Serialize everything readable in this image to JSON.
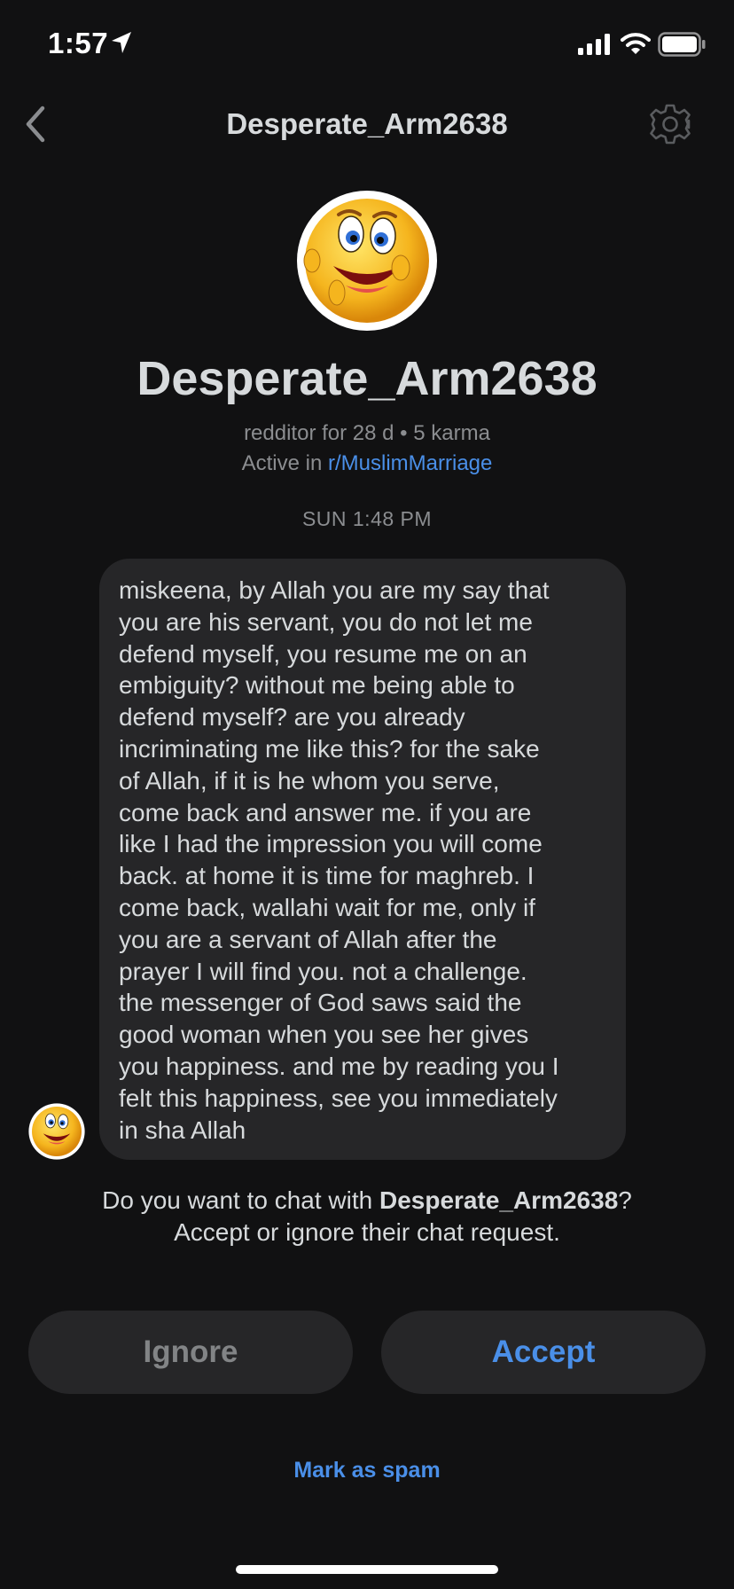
{
  "status_bar": {
    "time": "1:57"
  },
  "header": {
    "title": "Desperate_Arm2638",
    "back_icon": "chevron-left-icon",
    "settings_icon": "gear-icon"
  },
  "profile": {
    "name": "Desperate_Arm2638",
    "meta": "redditor for 28 d • 5 karma",
    "active_prefix": "Active in",
    "subreddit": "r/MuslimMarriage",
    "avatar_icon": "smiley-face-icon"
  },
  "conversation": {
    "timestamp": "SUN 1:48 PM",
    "message": "miskeena, by Allah you are my say that\nyou are his servant, you do not let me\ndefend myself, you resume me on an\nembiguity? without me being able to\ndefend myself? are you already\nincriminating me like this? for the sake\nof Allah, if it is he whom you serve,\ncome back and answer me. if you are\nlike I had the impression you will come\nback. at home it is time for maghreb. I\ncome back, wallahi wait for me, only if\nyou are a servant of Allah after the\nprayer I will find you. not a challenge.\nthe messenger of God saws said the\ngood woman when you see her gives\nyou happiness. and me by reading you I\nfelt this happiness, see you immediately\nin sha Allah"
  },
  "request": {
    "prompt_prefix": "Do you want to chat with",
    "username": "Desperate_Arm2638",
    "prompt_suffix": "?",
    "subprompt": "Accept or ignore their chat request."
  },
  "actions": {
    "ignore_label": "Ignore",
    "accept_label": "Accept",
    "spam_label": "Mark as spam"
  },
  "colors": {
    "background": "#111112",
    "bubble": "#262628",
    "accent": "#4a8fe8",
    "muted": "#8b8d90",
    "text": "#d7dadc"
  }
}
